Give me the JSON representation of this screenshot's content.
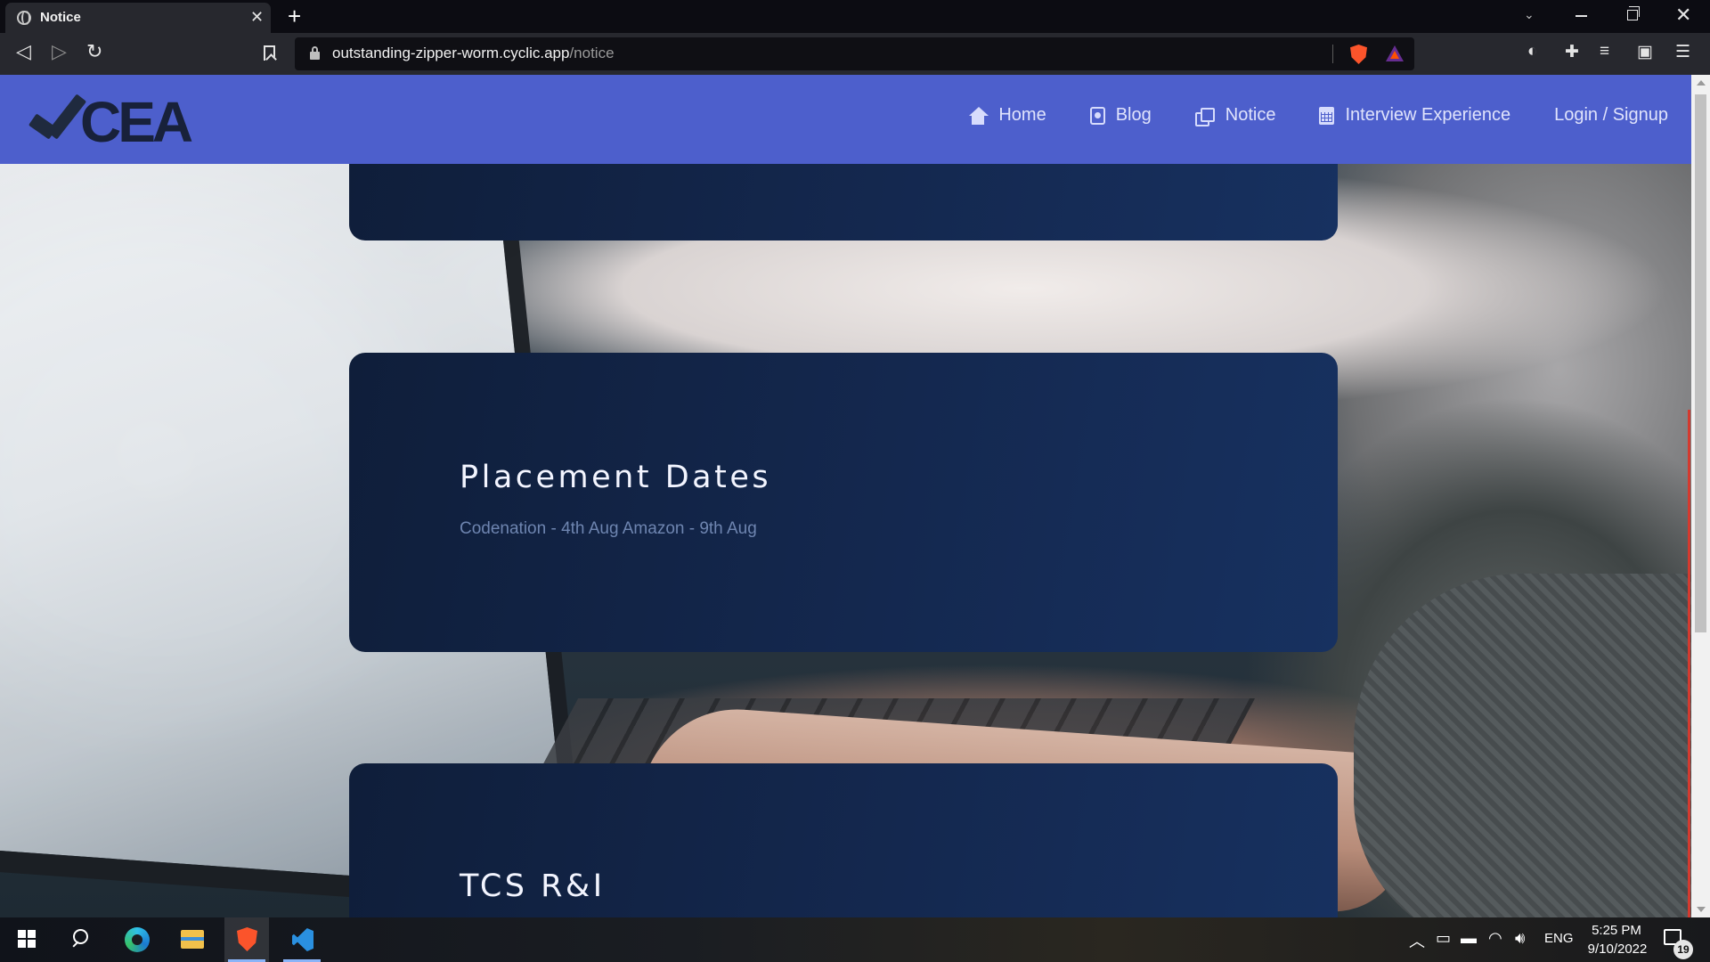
{
  "browser": {
    "tab_title": "Notice",
    "tab_close": "✕",
    "new_tab": "+",
    "url_host": "outstanding-zipper-worm.cyclic.app",
    "url_path": "/notice"
  },
  "site": {
    "logo_text": "CEA",
    "nav": [
      {
        "label": "Home",
        "icon": "home-icon"
      },
      {
        "label": "Blog",
        "icon": "blog-icon"
      },
      {
        "label": "Notice",
        "icon": "notice-icon"
      },
      {
        "label": "Interview Experience",
        "icon": "calendar-icon"
      },
      {
        "label": "Login / Signup",
        "icon": ""
      }
    ],
    "colors": {
      "header": "#4d5fcc",
      "card": "#14284f",
      "card_text": "#6e85b0"
    }
  },
  "notices": [
    {
      "title": "",
      "body": ""
    },
    {
      "title": "Placement Dates",
      "body": "Codenation - 4th Aug Amazon - 9th Aug"
    },
    {
      "title": "TCS R&I",
      "body": ""
    }
  ],
  "taskbar": {
    "apps": [
      "start-icon",
      "search-icon",
      "edge-icon",
      "file-explorer-icon",
      "brave-icon",
      "vscode-icon"
    ],
    "language": "ENG",
    "time": "5:25 PM",
    "date": "9/10/2022",
    "notification_count": "19"
  }
}
